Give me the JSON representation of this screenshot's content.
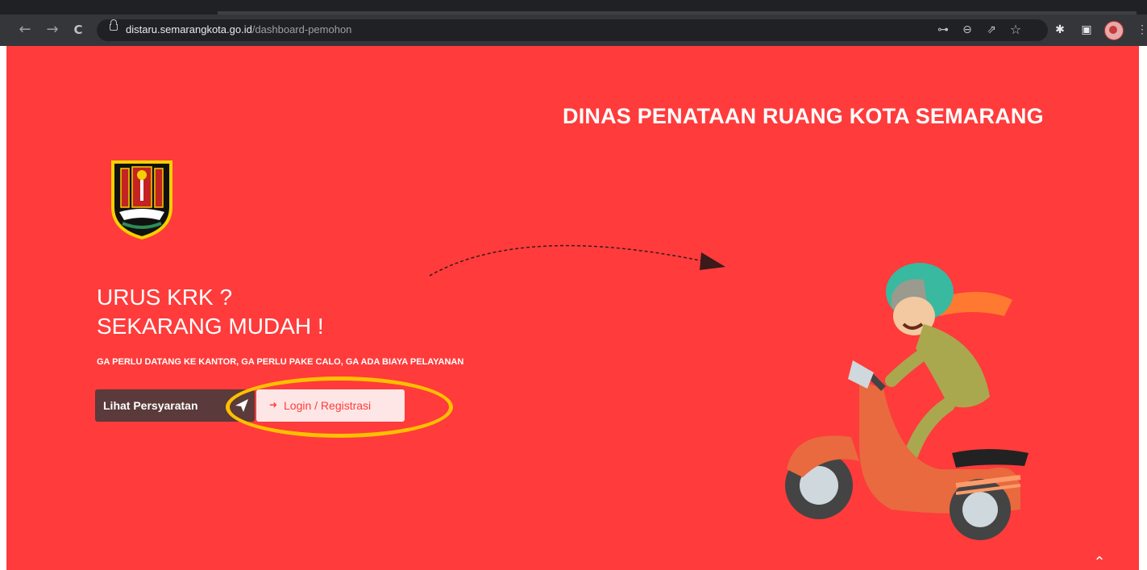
{
  "browser": {
    "url_host": "distaru.semarangkota.go.id",
    "url_path": "/dashboard-pemohon",
    "icons": [
      "back-icon",
      "forward-icon",
      "reload-icon",
      "lock-icon",
      "key-icon",
      "zoom-icon",
      "share-icon",
      "star-icon",
      "extensions-icon",
      "sidepanel-icon",
      "profile-avatar",
      "menu-icon"
    ],
    "glyphs": {
      "back": "←",
      "forward": "→",
      "reload": "C",
      "key": "⊶",
      "zoom": "⊖",
      "share": "⇗",
      "star": "☆",
      "extensions": "✱",
      "sidepanel": "▣",
      "menu": "⋮"
    }
  },
  "page": {
    "title": "DINAS PENATAAN RUANG KOTA SEMARANG",
    "headline_line1": "URUS KRK ?",
    "headline_line2": "SEKARANG MUDAH !",
    "subline": "GA PERLU DATANG KE KANTOR, GA PERLU PAKE CALO, GA ADA BIAYA PELAYANAN",
    "requirements_button": "Lihat Persyaratan",
    "login_button": "Login / Registrasi",
    "login_icon": "➜",
    "scroll_top_glyph": "⌃",
    "background_color": "#ff3b3b",
    "highlight_color": "#ffc000"
  }
}
